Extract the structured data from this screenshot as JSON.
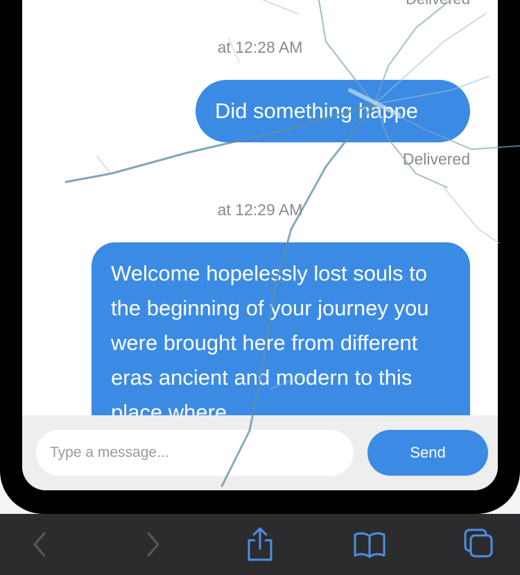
{
  "chat": {
    "status_top": "Delivered",
    "timestamp_1": "at 12:28 AM",
    "message_1": "Did something happe",
    "status_1": "Delivered",
    "timestamp_2": "at 12:29 AM",
    "message_2": "Welcome hopelessly lost souls to the beginning of your journey you were brought here from different eras ancient and modern to this place where"
  },
  "composer": {
    "placeholder": "Type a message...",
    "send_label": "Send"
  },
  "toolbar": {
    "icons": [
      "back-icon",
      "forward-icon",
      "share-icon",
      "bookmarks-icon",
      "tabs-icon"
    ]
  },
  "colors": {
    "bubble": "#3b8be5",
    "toolbar": "#2c2c2e",
    "toolbar_active": "#4a90e2",
    "toolbar_disabled": "#5a5a5e"
  }
}
